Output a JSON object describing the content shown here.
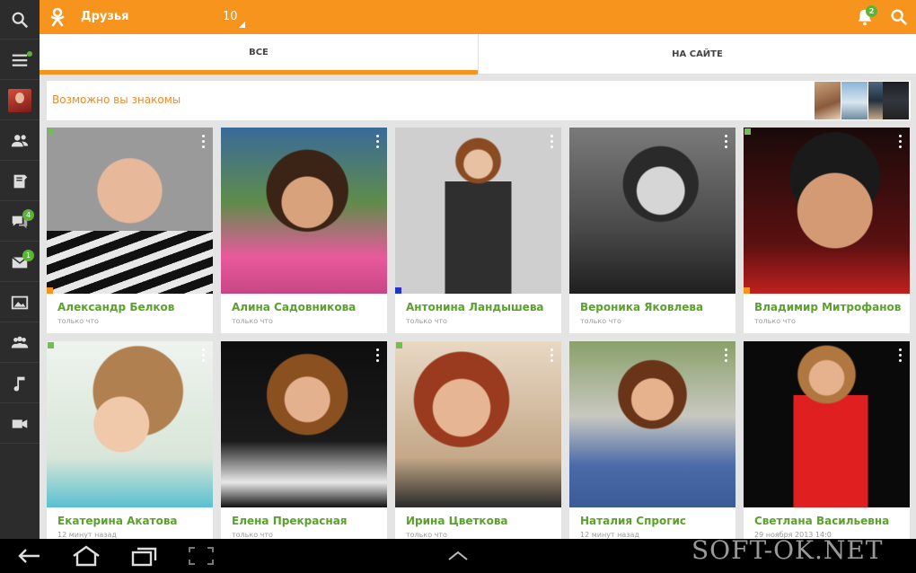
{
  "topbar": {
    "title": "Друзья",
    "count": "10",
    "notification_count": "2"
  },
  "tabs": {
    "all": "ВСЕ",
    "online": "НА САЙТЕ"
  },
  "suggestions": {
    "label": "Возможно вы знакомы"
  },
  "rail": {
    "chat_badge": "4",
    "mail_badge": "1"
  },
  "friends": [
    {
      "name": "Александр Белков",
      "status": "только что"
    },
    {
      "name": "Алина Садовникова",
      "status": "только что"
    },
    {
      "name": "Антонина Ландышева",
      "status": "только что"
    },
    {
      "name": "Вероника Яковлева",
      "status": "только что"
    },
    {
      "name": "Владимир Митрофанов",
      "status": "только что"
    },
    {
      "name": "Екатерина Акатова",
      "status": "12 минут назад"
    },
    {
      "name": "Елена Прекрасная",
      "status": "только что"
    },
    {
      "name": "Ирина Цветкова",
      "status": "только что"
    },
    {
      "name": "Наталия Спрогис",
      "status": "12 минут назад"
    },
    {
      "name": "Светлана Васильевна",
      "status": "29 ноября 2013 14:0"
    }
  ],
  "watermark": "SOFT-OK.NET",
  "colors": {
    "accent": "#f7941d",
    "name_green": "#5aa22c",
    "rail": "#2c2c2c"
  }
}
